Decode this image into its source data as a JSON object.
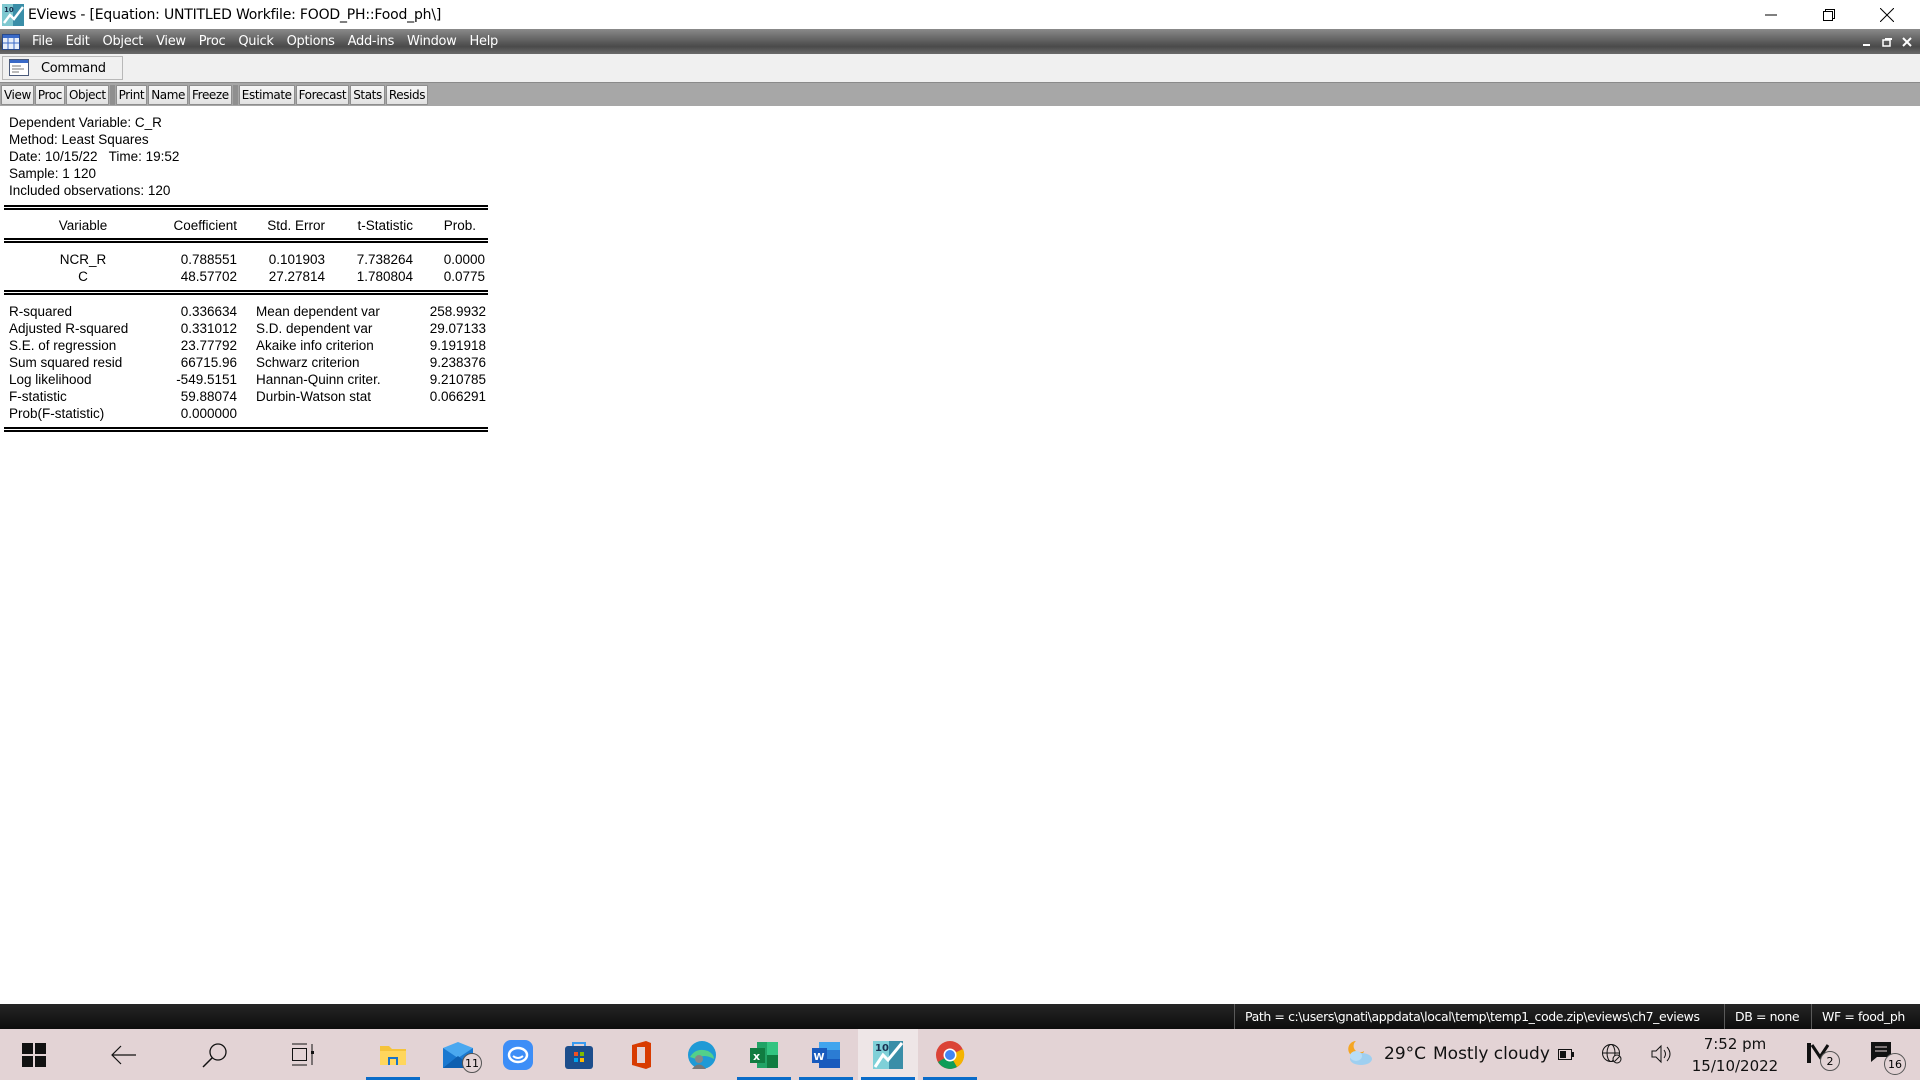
{
  "window": {
    "title": "EViews - [Equation: UNTITLED   Workfile: FOOD_PH::Food_ph\\]",
    "app_icon": "eviews-10-icon",
    "controls": [
      "minimize-icon",
      "restore-icon",
      "close-icon"
    ]
  },
  "menubar": {
    "items": [
      "File",
      "Edit",
      "Object",
      "View",
      "Proc",
      "Quick",
      "Options",
      "Add-ins",
      "Window",
      "Help"
    ],
    "mdi_controls": [
      "minimize-icon",
      "restore-icon",
      "close-icon"
    ]
  },
  "command_bar": {
    "label": "Command"
  },
  "object_toolbar": {
    "groups": [
      [
        "View",
        "Proc",
        "Object"
      ],
      [
        "Print",
        "Name",
        "Freeze"
      ],
      [
        "Estimate",
        "Forecast",
        "Stats",
        "Resids"
      ]
    ]
  },
  "output": {
    "header": [
      "Dependent Variable: C_R",
      "Method: Least Squares",
      "Date: 10/15/22   Time: 19:52",
      "Sample: 1 120",
      "Included observations: 120"
    ],
    "columns": [
      "Variable",
      "Coefficient",
      "Std. Error",
      "t-Statistic",
      "Prob."
    ],
    "rows": [
      [
        "NCR_R",
        "0.788551",
        "0.101903",
        "7.738264",
        "0.0000"
      ],
      [
        "C",
        "48.57702",
        "27.27814",
        "1.780804",
        "0.0775"
      ]
    ],
    "stats": [
      [
        "R-squared",
        "0.336634",
        "Mean dependent var",
        "258.9932"
      ],
      [
        "Adjusted R-squared",
        "0.331012",
        "S.D. dependent var",
        "29.07133"
      ],
      [
        "S.E. of regression",
        "23.77792",
        "Akaike info criterion",
        "9.191918"
      ],
      [
        "Sum squared resid",
        "66715.96",
        "Schwarz criterion",
        "9.238376"
      ],
      [
        "Log likelihood",
        "-549.5151",
        "Hannan-Quinn criter.",
        "9.210785"
      ],
      [
        "F-statistic",
        "59.88074",
        "Durbin-Watson stat",
        "0.066291"
      ],
      [
        "Prob(F-statistic)",
        "0.000000",
        "",
        ""
      ]
    ]
  },
  "statusbar": {
    "path": "Path = c:\\users\\gnati\\appdata\\local\\temp\\temp1_code.zip\\eviews\\ch7_eviews",
    "db": "DB = none",
    "wf": "WF = food_ph"
  },
  "taskbar": {
    "apps": [
      {
        "name": "file-explorer",
        "active": false,
        "running": true
      },
      {
        "name": "mail",
        "badge": "11"
      },
      {
        "name": "chat-app"
      },
      {
        "name": "microsoft-store"
      },
      {
        "name": "office"
      },
      {
        "name": "edge"
      },
      {
        "name": "excel",
        "running": true
      },
      {
        "name": "word",
        "running": true
      },
      {
        "name": "eviews",
        "active": true,
        "running": true
      },
      {
        "name": "chrome",
        "running": true
      }
    ],
    "weather": {
      "temp": "29°C",
      "condition": "Mostly cloudy"
    },
    "clock": {
      "time": "7:52 pm",
      "date": "15/10/2022"
    },
    "meet_badge": "2",
    "notifications_badge": "16"
  },
  "colors": {
    "menubar": "#5c5c5c",
    "toolbar": "#a7a7a7",
    "statusbar": "#1a1a1a",
    "taskbar": "#e3d3d5",
    "accent": "#0a6cc9"
  }
}
